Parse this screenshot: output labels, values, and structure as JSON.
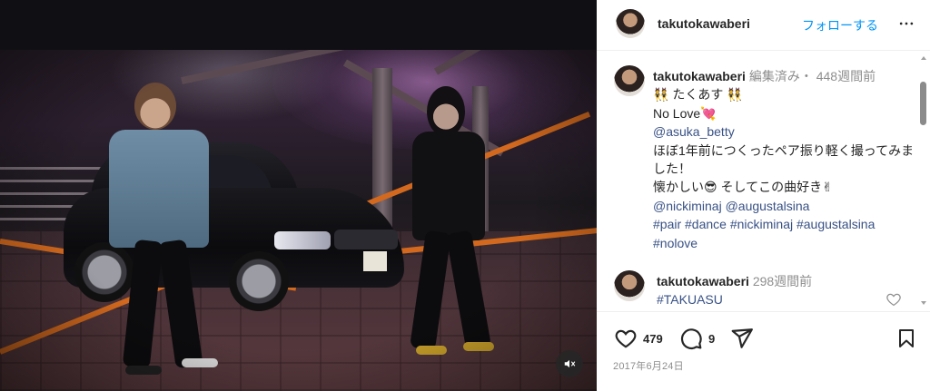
{
  "post": {
    "username": "takutokawaberi",
    "follow_label": "フォローする",
    "caption": {
      "username": "takutokawaberi",
      "edited": "編集済み",
      "separator": "・",
      "time": "448週間前",
      "line1": "👯 たくあす 👯",
      "line2": "No Love💘",
      "mention1": "@asuka_betty",
      "line3": "ほぼ1年前につくったペア振り軽く撮ってみました！",
      "line4": "懐かしい😎 そしてこの曲好き✌",
      "mention2": "@nickiminaj",
      "mention3": "@augustalsina",
      "hashtags1": "#pair #dance #nickiminaj #augustalsina",
      "hashtags2": "#nolove"
    },
    "reply": {
      "username": "takutokawaberi",
      "time": "298週間前",
      "text": "#TAKUASU"
    },
    "likes": "479",
    "comments_count": "9",
    "date": "2017年6月24日"
  },
  "colors": {
    "link": "#385185",
    "follow": "#0095f6",
    "muted": "#8e8e8e"
  }
}
